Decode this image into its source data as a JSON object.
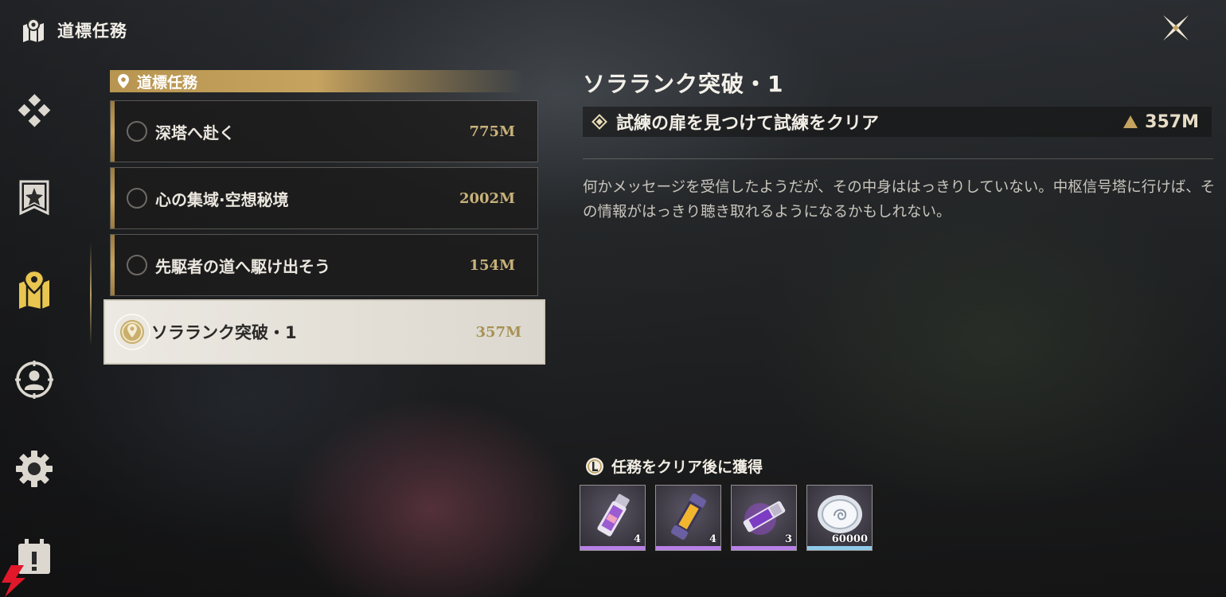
{
  "header": {
    "title": "道標任務",
    "icon": "map-icon"
  },
  "close_icon": "close-icon",
  "sidebar": {
    "items": [
      {
        "name": "diamond-grid-icon",
        "active": false
      },
      {
        "name": "banner-star-icon",
        "active": false
      },
      {
        "name": "map-pin-icon",
        "active": true
      },
      {
        "name": "target-person-icon",
        "active": false
      },
      {
        "name": "gear-icon",
        "active": false
      },
      {
        "name": "calendar-alert-icon",
        "active": false
      }
    ]
  },
  "quest_list": {
    "header": "道標任務",
    "items": [
      {
        "name": "深塔へ赴く",
        "distance": "775M"
      },
      {
        "name": "心の集域·空想秘境",
        "distance": "2002M"
      },
      {
        "name": "先駆者の道へ駆け出そう",
        "distance": "154M"
      },
      {
        "name": "ソラランク突破・1",
        "distance": "357M",
        "selected": true
      }
    ]
  },
  "detail": {
    "title": "ソラランク突破・1",
    "objective": "試練の扉を見つけて試練をクリア",
    "distance": "357M",
    "description": "何かメッセージを受信したようだが、その中身ははっきりしていない。中枢信号塔に行けば、その情報がはっきり聴き取れるようになるかもしれない。"
  },
  "rewards": {
    "label": "任務をクリア後に獲得",
    "items": [
      {
        "name": "purple-vial-item",
        "qty": "4",
        "rarity": "purple"
      },
      {
        "name": "gold-capsule-item",
        "qty": "4",
        "rarity": "purple"
      },
      {
        "name": "purple-cartridge-item",
        "qty": "3",
        "rarity": "purple"
      },
      {
        "name": "silver-coin-item",
        "qty": "60000",
        "rarity": "blue"
      }
    ]
  },
  "colors": {
    "accent": "#c6a35f",
    "purple": "#b780e6",
    "blue": "#8fc9e8"
  }
}
